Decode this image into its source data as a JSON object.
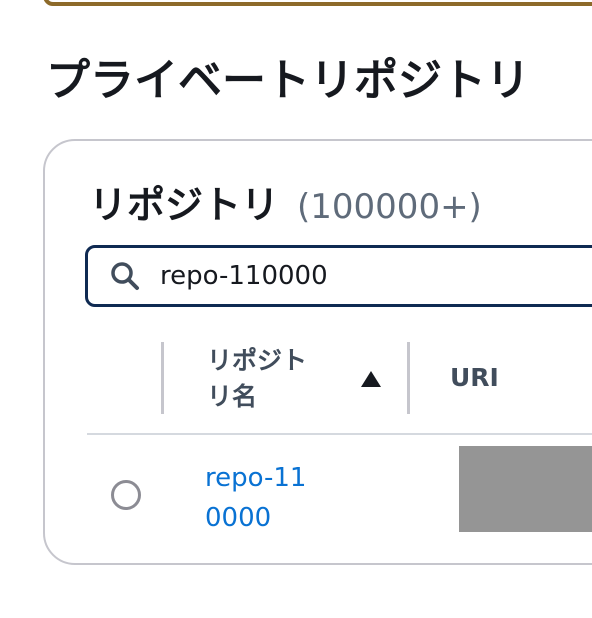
{
  "page": {
    "title": "プライベートリポジトリ"
  },
  "repositories_panel": {
    "title": "リポジトリ",
    "count": "(100000+)",
    "search": {
      "value": "repo-110000",
      "icon": "search-icon"
    },
    "table": {
      "columns": [
        {
          "label": "リポジトリ名",
          "sort": "ascending"
        },
        {
          "label": "URI"
        }
      ],
      "rows": [
        {
          "name": "repo-110000",
          "uri": "",
          "uri_redacted": true,
          "selected": false
        }
      ]
    }
  },
  "colors": {
    "link": "#0972d3",
    "search_border": "#0f2a52",
    "banner_border": "#8d6a2a",
    "redaction": "#959595"
  }
}
